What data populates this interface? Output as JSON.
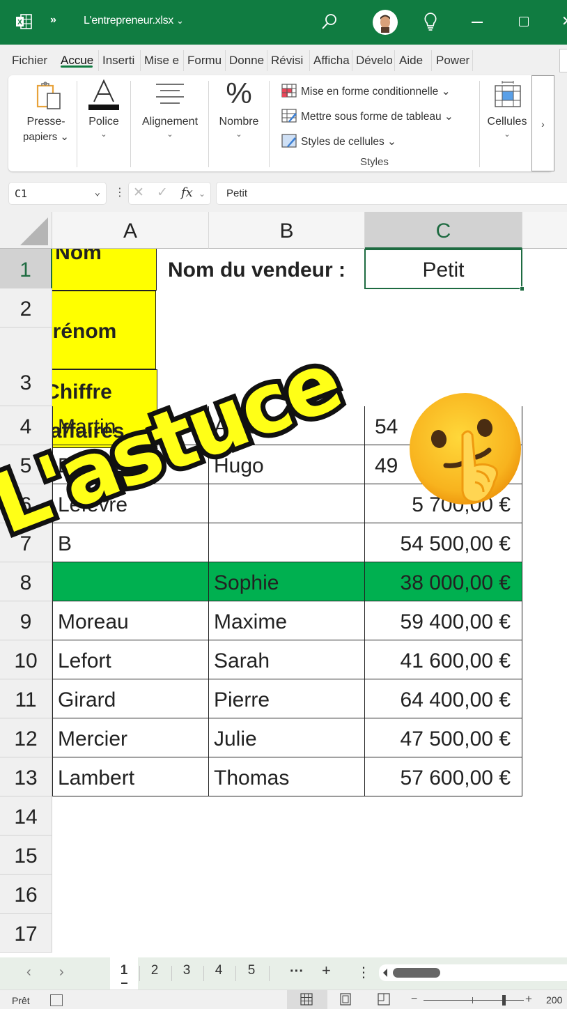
{
  "titlebar": {
    "more_label": "»",
    "filename": "L'entrepreneur.xlsx",
    "filename_chevron": "⌄"
  },
  "tabs": [
    {
      "label": "Fichier"
    },
    {
      "label": "Accue",
      "active": true
    },
    {
      "label": "Inserti"
    },
    {
      "label": "Mise e"
    },
    {
      "label": "Formu"
    },
    {
      "label": "Donne"
    },
    {
      "label": "Révisi"
    },
    {
      "label": "Afficha"
    },
    {
      "label": "Dévelo"
    },
    {
      "label": "Aide"
    },
    {
      "label": "Power"
    }
  ],
  "ribbon": {
    "clipboard": {
      "label_line1": "Presse-",
      "label_line2": "papiers ⌄"
    },
    "font": {
      "label": "Police",
      "dropdown": "⌄"
    },
    "alignment": {
      "label": "Alignement",
      "dropdown": "⌄"
    },
    "number": {
      "label": "Nombre",
      "dropdown": "⌄",
      "icon_glyph": "%"
    },
    "styles": {
      "conditional_formatting": "Mise en forme conditionnelle ⌄",
      "format_as_table": "Mettre sous forme de tableau ⌄",
      "cell_styles": "Styles de cellules ⌄",
      "group_label": "Styles"
    },
    "cells": {
      "label": "Cellules",
      "dropdown": "⌄"
    },
    "more_glyph": "›"
  },
  "formula_bar": {
    "name_box": "C1",
    "name_box_chevron": "⌄",
    "separator": "⋮",
    "cancel_glyph": "✕",
    "enter_glyph": "✓",
    "fx_glyph": "fx",
    "fx_chevron": "⌄",
    "value": "Petit"
  },
  "columns": [
    "A",
    "B",
    "C"
  ],
  "selected_column": "C",
  "rows": [
    "1",
    "2",
    "3",
    "4",
    "5",
    "6",
    "7",
    "8",
    "9",
    "10",
    "11",
    "12",
    "13",
    "14",
    "15",
    "16",
    "17"
  ],
  "selected_row": "1",
  "sheet": {
    "vendeur_label": "Nom du vendeur :",
    "vendeur_value": "Petit",
    "headers": [
      "Nom",
      "Prénom",
      "Chiffre d'affaires"
    ],
    "data": [
      {
        "nom": "Martin",
        "prenom": "Alice",
        "ca": "54"
      },
      {
        "nom": "Dupont",
        "prenom": "Hugo",
        "ca": "49"
      },
      {
        "nom": "Lefevre",
        "prenom": "",
        "ca": "5 700,00 €"
      },
      {
        "nom": "B",
        "prenom": "",
        "ca": "54 500,00 €"
      },
      {
        "nom": "",
        "prenom": "Sophie",
        "ca": "38 000,00 €",
        "highlight": true
      },
      {
        "nom": "Moreau",
        "prenom": "Maxime",
        "ca": "59 400,00 €"
      },
      {
        "nom": "Lefort",
        "prenom": "Sarah",
        "ca": "41 600,00 €"
      },
      {
        "nom": "Girard",
        "prenom": "Pierre",
        "ca": "64 400,00 €"
      },
      {
        "nom": "Mercier",
        "prenom": "Julie",
        "ca": "47 500,00 €"
      },
      {
        "nom": "Lambert",
        "prenom": "Thomas",
        "ca": "57 600,00 €"
      }
    ]
  },
  "colors": {
    "excel_green": "#107c41",
    "header_yellow": "#ffff00",
    "highlight_green": "#00b050",
    "overlay_yellow": "#ffff17"
  },
  "overlay": {
    "text": "L'astuce",
    "emoji": "shushing-face"
  },
  "sheet_tabs": {
    "prev": "‹",
    "next": "›",
    "tabs": [
      "1",
      "2",
      "3",
      "4",
      "5"
    ],
    "active": "1",
    "overflow": "···",
    "add": "+",
    "menu": "⋮"
  },
  "status": {
    "ready": "Prêt",
    "zoom_minus": "−",
    "zoom_plus": "+",
    "zoom_percent": "200",
    "zoom_level_fraction": 0.8
  }
}
